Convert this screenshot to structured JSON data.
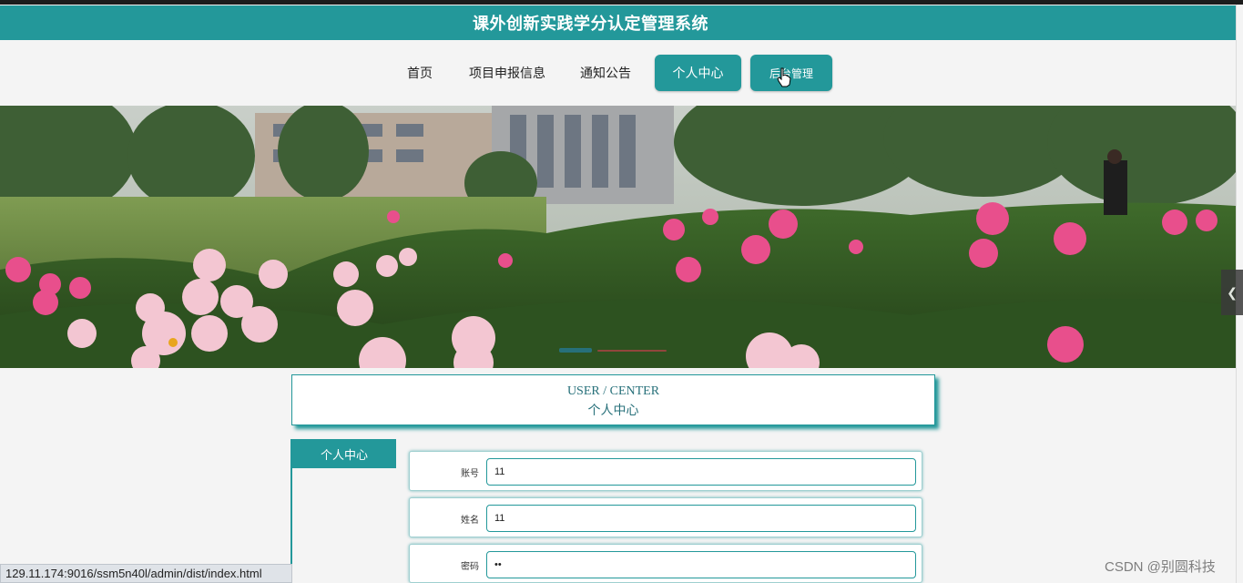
{
  "header": {
    "title": "课外创新实践学分认定管理系统"
  },
  "nav": {
    "items": [
      "首页",
      "项目申报信息",
      "通知公告"
    ],
    "buttons": [
      "个人中心",
      "后台管理"
    ]
  },
  "section": {
    "title_en": "USER / CENTER",
    "title_cn": "个人中心"
  },
  "sidebar": {
    "active_item": "个人中心"
  },
  "form": {
    "fields": [
      {
        "label": "账号",
        "value": "11"
      },
      {
        "label": "姓名",
        "value": "11"
      },
      {
        "label": "密码",
        "value": "••"
      }
    ]
  },
  "status_bar": {
    "url": "129.11.174:9016/ssm5n40l/admin/dist/index.html"
  },
  "watermark": {
    "text": "CSDN @别圆科技"
  },
  "colors": {
    "accent": "#23989a",
    "accent_dark": "#27707a",
    "background": "#f4f4f4"
  },
  "icons": {
    "carousel_prev": "chevron-left-icon",
    "cursor": "hand-pointer-icon"
  }
}
